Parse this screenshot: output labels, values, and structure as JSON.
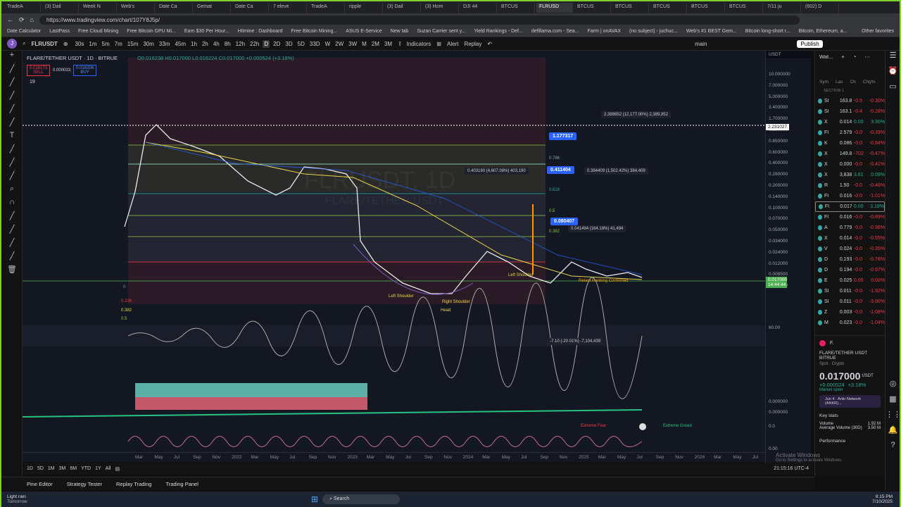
{
  "browser": {
    "tabs": [
      "TradeA",
      "(3) Dail",
      "Week N",
      "Web's",
      "Date Ca",
      "Gemat",
      "Date Ca",
      "7 eleve",
      "TradeA",
      "ripple",
      "(3) Dail",
      "(3) Hom",
      "DJI 44",
      "BTCUS",
      "FLRUSD",
      "BTCUS",
      "BTCUS",
      "BTCUS",
      "BTCUS",
      "BTCUS",
      "7/11 ju",
      "(602) D"
    ],
    "active_tab": 14,
    "url": "https://www.tradingview.com/chart/107Y8J5p/",
    "bookmarks": [
      "Date Calculator",
      "LastPass",
      "Free Cloud Mining",
      "Free Bitcoin GPU Mi...",
      "Earn $30 Per Hour...",
      "Hitmine : Dashboard",
      "Free Bitcoin Mining...",
      "ASUS E-Service",
      "New tab",
      "Suzan Carrier sent y...",
      "Yield Rankings - Def...",
      "defillama.com - Sea...",
      "Farm | onAVAX",
      "(no subject) - juchuc...",
      "Web's #1 BEST Gem...",
      "Bitcoin long-short r...",
      "Bitcoin, Ethereum, a..."
    ],
    "other_favorites": "Other favorites"
  },
  "toolbar": {
    "avatar": "J",
    "avatar_badge": "11",
    "symbol": "FLRUSDT",
    "intervals": [
      "30s",
      "1m",
      "5m",
      "7m",
      "15m",
      "30m",
      "33m",
      "45m",
      "1h",
      "2h",
      "4h",
      "8h",
      "12h",
      "22h",
      "D",
      "2D",
      "3D",
      "5D",
      "33D",
      "W",
      "2W",
      "3W",
      "M",
      "2M",
      "3M"
    ],
    "selected_interval": "D",
    "indicators": "Indicators",
    "alert": "Alert",
    "replay": "Replay",
    "layout": "main",
    "publish": "Publish"
  },
  "legend": {
    "title": "FLARE/TETHER USDT · 1D · BITRUE",
    "ohlc": "O0.016238 H0.017000 L0.016224 C0.017000 +0.000524 (+3.18%)",
    "sell_price": "0.016173",
    "sell": "SELL",
    "spread": "0.000033",
    "buy_price": "0.016206",
    "buy": "BUY",
    "indicator_count": "19"
  },
  "chart": {
    "watermark": "FLRUSDT, 1D",
    "watermark_sub": "FLARE/TETHER USDT",
    "labels": {
      "a": "1.177317",
      "b": "0.411404",
      "c": "0.080407"
    },
    "notes": [
      "2.389852 (12,177.00%) 2,389,852",
      "0.403190 (4,607.08%) 403,190",
      "0.384409 (1,502.42%) 384,409",
      "0.041494 (164.18%) 41,494",
      "-7.10 (-20.01%) -7,104,439"
    ],
    "fib": [
      "0.786",
      "0.618",
      "0.5",
      "0.382",
      "0.236",
      "0",
      "0.382",
      "0.5"
    ],
    "annotations": [
      "Left Shoulder",
      "Right Shoulder",
      "Head",
      "Left Shoulder",
      "Retest Ranking Confirmed"
    ],
    "fear_greed": {
      "fear": "Extreme Fear",
      "greed": "Extreme Greed"
    }
  },
  "price_axis": {
    "currency": "USDT",
    "ticks": [
      "10.000000",
      "7.000000",
      "5.000000",
      "3.400000",
      "1.700000",
      "1.200000",
      "0.850000",
      "0.600000",
      "0.400000",
      "0.280000",
      "0.200000",
      "0.140000",
      "0.100000",
      "0.070000",
      "0.050000",
      "0.034000",
      "0.024000",
      "0.012000",
      "0.008500",
      "0.005900"
    ],
    "crosshair": "2.231027",
    "last_price": "0.017000",
    "countdown": "14:44:44",
    "osc1": "80.00",
    "osc2": "0.000000",
    "osc3": "0.000000",
    "osc4": "0.0",
    "osc5": "0.00"
  },
  "time_axis": [
    "Mar",
    "May",
    "Jul",
    "Sep",
    "Nov",
    "2022",
    "Mar",
    "May",
    "Jul",
    "Sep",
    "Nov",
    "2023",
    "Mar",
    "May",
    "Jul",
    "Sep",
    "Nov",
    "2024",
    "Mar",
    "May",
    "Jul",
    "Sep",
    "Nov",
    "2025",
    "Mar",
    "May",
    "Jul",
    "Sep",
    "Nov",
    "2026",
    "Mar",
    "May",
    "Jul"
  ],
  "range": {
    "buttons": [
      "1D",
      "5D",
      "1M",
      "3M",
      "6M",
      "YTD",
      "1Y",
      "All"
    ],
    "clock": "21:15:16 UTC-4"
  },
  "bottom": {
    "tabs": [
      "Pine Editor",
      "Strategy Tester",
      "Replay Trading",
      "Trading Panel"
    ]
  },
  "watchlist": {
    "title": "Wat...",
    "headers": [
      "Sym",
      "Las",
      "Ch",
      "Chg%"
    ],
    "section": "SECTION 1",
    "rows": [
      [
        "SI",
        "163.8",
        "-0.5",
        "-0.30%"
      ],
      [
        "SI",
        "163.1",
        "-0.4",
        "-0.28%"
      ],
      [
        "X",
        "0.014",
        "0.00",
        "3.30%"
      ],
      [
        "FI",
        "2.579",
        "-0.0",
        "-0.39%"
      ],
      [
        "K",
        "0.086",
        "-0.0",
        "-0.84%"
      ],
      [
        "X",
        "149.8",
        "-702",
        "-0.47%"
      ],
      [
        "X",
        "0.000",
        "-0.0",
        "-0.41%"
      ],
      [
        "X",
        "3,838",
        "3.61",
        "0.09%"
      ],
      [
        "R",
        "1.50",
        "-0.0",
        "-0.46%"
      ],
      [
        "FI",
        "0.016",
        "-0.0",
        "-1.01%"
      ],
      [
        "FI",
        "0.017",
        "0.00",
        "3.18%"
      ],
      [
        "FI",
        "0.016",
        "-0.0",
        "-0.89%"
      ],
      [
        "A",
        "0.779",
        "-0.0",
        "-0.96%"
      ],
      [
        "X",
        "0.014",
        "-0.0",
        "-0.55%"
      ],
      [
        "V",
        "0.024",
        "-0.0",
        "-0.35%"
      ],
      [
        "D",
        "0.193",
        "-0.0",
        "-0.78%"
      ],
      [
        "D",
        "0.194",
        "-0.0",
        "-0.97%"
      ],
      [
        "E",
        "0.025",
        "0.00",
        "0.00%"
      ],
      [
        "SI",
        "0.011",
        "-0.0",
        "-1.92%"
      ],
      [
        "SI",
        "0.011",
        "-0.0",
        "-3.00%"
      ],
      [
        "Z",
        "0.003",
        "-0.0",
        "-1.08%"
      ],
      [
        "M",
        "0.023",
        "-0.0",
        "-1.04%"
      ]
    ],
    "selected_row": 10
  },
  "details": {
    "short": "F.",
    "name": "FLARE/TETHER USDT",
    "exchange": "BITRUE",
    "type": "Spot · Crypto",
    "price": "0.017000",
    "currency": "USDT",
    "change": "+0.000524",
    "change_pct": "+3.18%",
    "status": "Market open",
    "event": "Jun 4 · Ankr Network (ANKR)...",
    "key_stats": "Key stats",
    "volume_label": "Volume",
    "volume": "1.92 M",
    "avg_volume_label": "Average Volume (30D)",
    "avg_volume": "3.50 M",
    "performance": "Performance"
  },
  "taskbar": {
    "weather": "Light rain",
    "weather_sub": "Tomorrow",
    "search": "Search",
    "time": "8:15 PM",
    "date": "7/10/2025",
    "activate": "Activate Windows",
    "activate_sub": "Go to Settings to activate Windows."
  }
}
